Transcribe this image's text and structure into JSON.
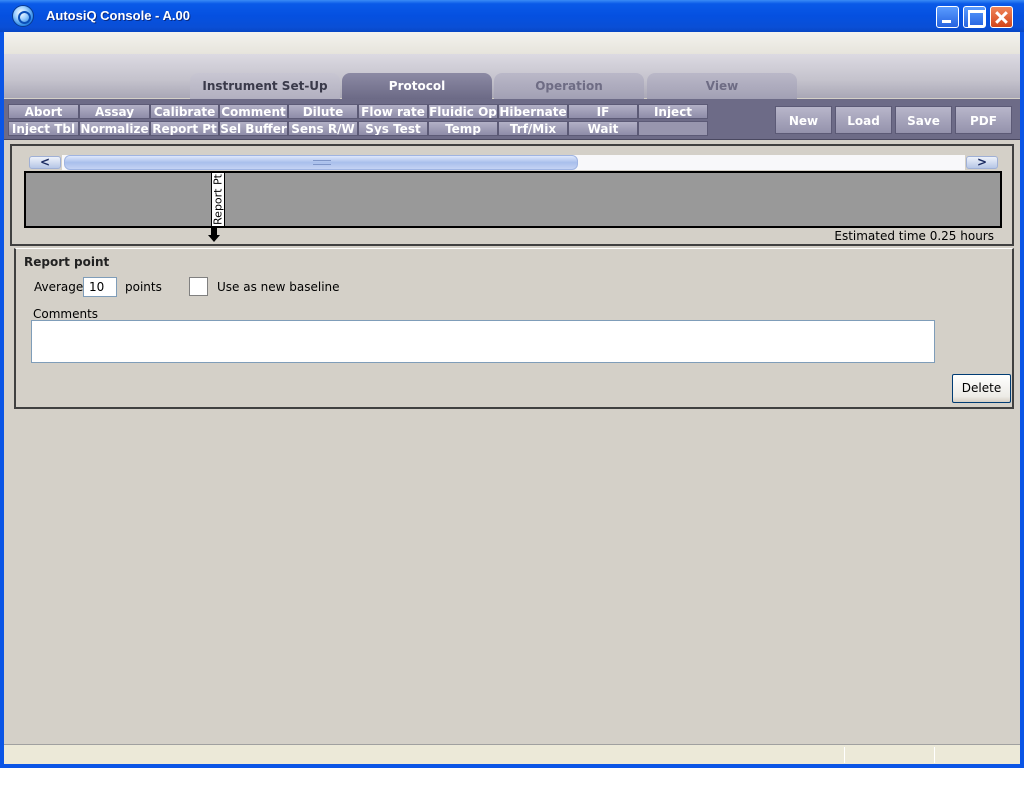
{
  "window": {
    "title": "AutosiQ Console - A.00"
  },
  "tabs": [
    {
      "label": "Instrument Set-Up"
    },
    {
      "label": "Protocol"
    },
    {
      "label": "Operation"
    },
    {
      "label": "View"
    }
  ],
  "commands_row1": [
    "Abort",
    "Assay",
    "Calibrate",
    "Comment",
    "Dilute",
    "Flow rate",
    "Fluidic Op",
    "Hibernate",
    "IF",
    "Inject"
  ],
  "commands_row2": [
    "Inject Tbl",
    "Normalize",
    "Report Pt",
    "Sel Buffer",
    "Sens R/W",
    "Sys Test",
    "Temp",
    "Trf/Mix",
    "Wait"
  ],
  "file_buttons": [
    "New",
    "Load",
    "Save",
    "PDF"
  ],
  "timeline": {
    "marker_label": "Report Pt",
    "estimated_time": "Estimated time 0.25 hours",
    "scroll_left": "<",
    "scroll_right": ">"
  },
  "detail": {
    "title": "Report point",
    "average_label": "Average",
    "average_value": "10",
    "points_label": "points",
    "baseline_label": "Use as new baseline",
    "baseline_checked": false,
    "comments_label": "Comments",
    "comments_value": "",
    "delete_label": "Delete"
  }
}
